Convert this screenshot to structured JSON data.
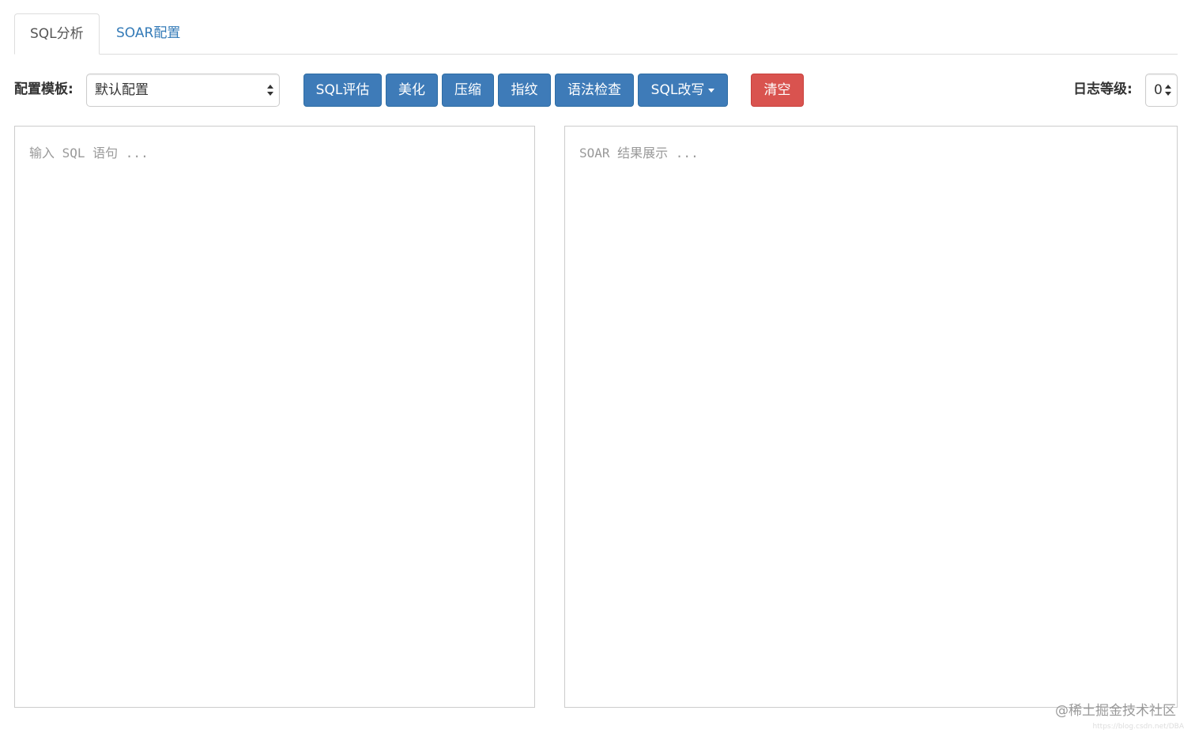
{
  "tabs": [
    {
      "label": "SQL分析",
      "active": true
    },
    {
      "label": "SOAR配置",
      "active": false
    }
  ],
  "toolbar": {
    "template_label": "配置模板:",
    "template_selected": "默认配置",
    "buttons": {
      "evaluate": "SQL评估",
      "beautify": "美化",
      "compress": "压缩",
      "fingerprint": "指纹",
      "syntax_check": "语法检查",
      "rewrite": "SQL改写",
      "clear": "清空"
    },
    "log_level_label": "日志等级:",
    "log_level_selected": "0"
  },
  "editor": {
    "input_placeholder": "输入 SQL 语句 ...",
    "output_placeholder": "SOAR 结果展示 ..."
  },
  "watermark": {
    "text": "@稀土掘金技术社区",
    "sub": "https://blog.csdn.net/DBA"
  },
  "colors": {
    "primary": "#3e7bb8",
    "danger": "#d9534f",
    "link": "#337ab7"
  }
}
